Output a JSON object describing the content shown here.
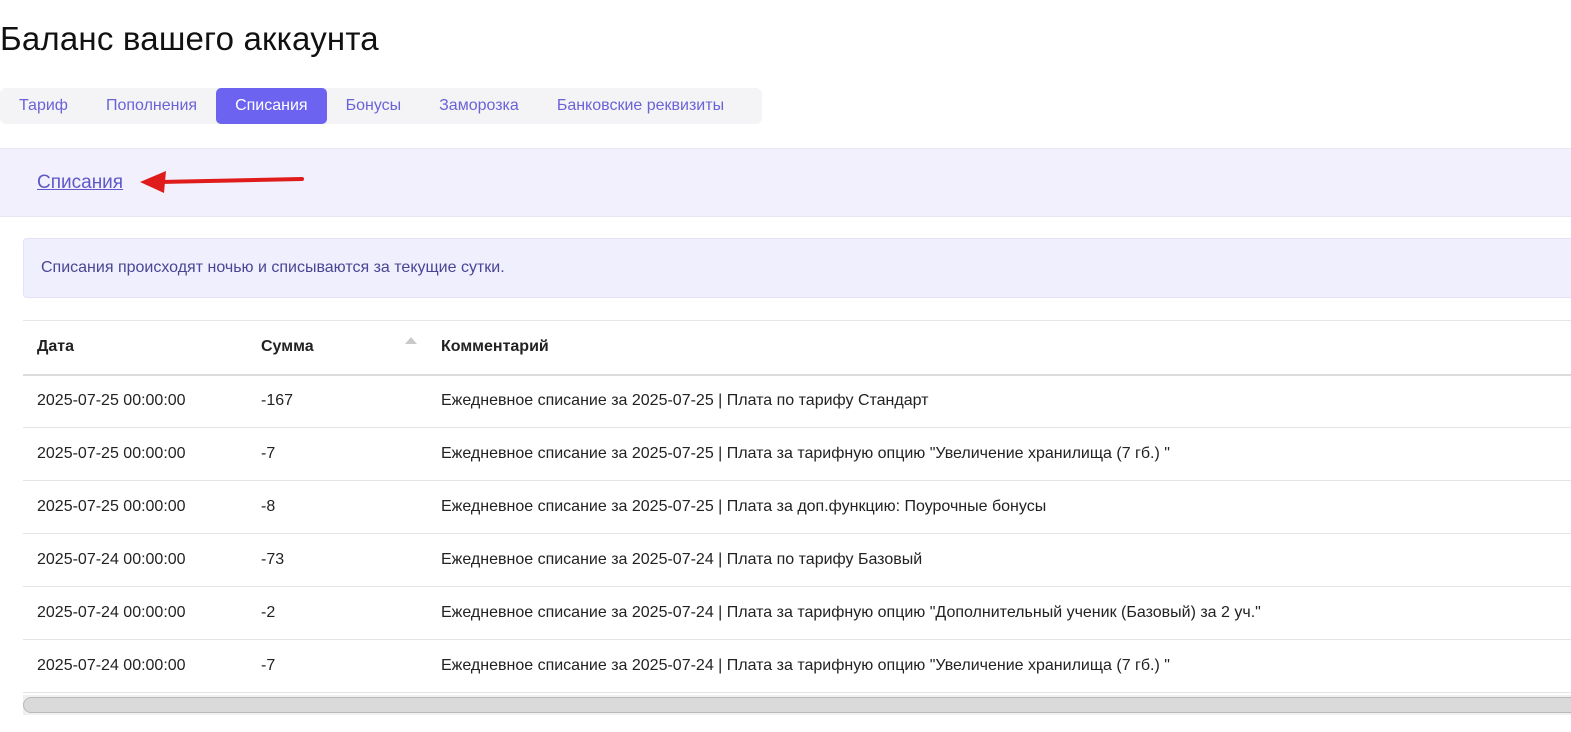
{
  "page": {
    "title": "Баланс вашего аккаунта"
  },
  "tabs": [
    {
      "label": "Тариф",
      "active": false
    },
    {
      "label": "Пополнения",
      "active": false
    },
    {
      "label": "Списания",
      "active": true
    },
    {
      "label": "Бонусы",
      "active": false
    },
    {
      "label": "Заморозка",
      "active": false
    },
    {
      "label": "Банковские реквизиты",
      "active": false
    }
  ],
  "section": {
    "link_label": "Списания"
  },
  "info": {
    "text": "Списания происходят ночью и списываются за текущие сутки."
  },
  "table": {
    "headers": {
      "date": "Дата",
      "sum": "Сумма",
      "comment": "Комментарий"
    },
    "rows": [
      {
        "date": "2025-07-25 00:00:00",
        "sum": "-167",
        "comment": "Ежедневное списание за 2025-07-25 | Плата по тарифу Стандарт"
      },
      {
        "date": "2025-07-25 00:00:00",
        "sum": "-7",
        "comment": "Ежедневное списание за 2025-07-25 | Плата за тарифную опцию \"Увеличение хранилища (7 гб.) \""
      },
      {
        "date": "2025-07-25 00:00:00",
        "sum": "-8",
        "comment": "Ежедневное списание за 2025-07-25 | Плата за доп.функцию: Поурочные бонусы"
      },
      {
        "date": "2025-07-24 00:00:00",
        "sum": "-73",
        "comment": "Ежедневное списание за 2025-07-24 | Плата по тарифу Базовый"
      },
      {
        "date": "2025-07-24 00:00:00",
        "sum": "-2",
        "comment": "Ежедневное списание за 2025-07-24 | Плата за тарифную опцию \"Дополнительный ученик (Базовый) за 2 уч.\""
      },
      {
        "date": "2025-07-24 00:00:00",
        "sum": "-7",
        "comment": "Ежедневное списание за 2025-07-24 | Плата за тарифную опцию \"Увеличение хранилища (7 гб.) \""
      }
    ]
  },
  "colors": {
    "accent": "#6c63f0",
    "link": "#5e58c9",
    "annotation_arrow": "#e01b1b"
  },
  "icons": {
    "sort": "sort-asc-icon",
    "annotation": "red-arrow-icon"
  }
}
